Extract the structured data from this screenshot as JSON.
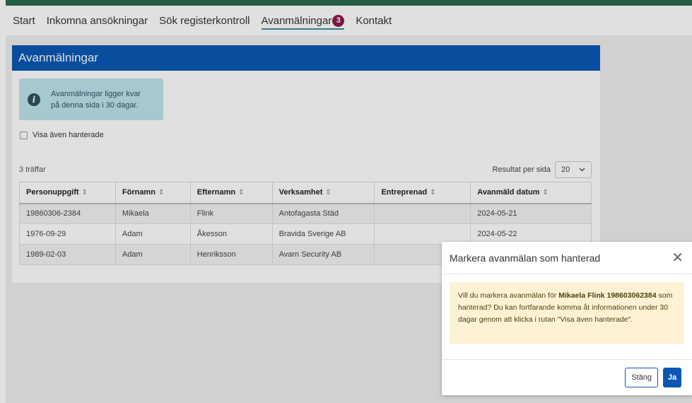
{
  "nav": {
    "items": [
      "Start",
      "Inkomna ansökningar",
      "Sök registerkontroll",
      "Avanmälningar",
      "Kontakt"
    ],
    "badge": "3"
  },
  "card": {
    "title": "Avanmälningar",
    "info_text": "Avanmälningar ligger kvar på denna sida i 30 dagar.",
    "checkbox_label": "Visa även hanterade",
    "hits": "3 träffar",
    "per_page_label": "Resultat per sida",
    "per_page_value": "20"
  },
  "table": {
    "headers": [
      "Personuppgift",
      "Förnamn",
      "Efternamn",
      "Verksamhet",
      "Entreprenad",
      "Avanmäld datum"
    ],
    "rows": [
      [
        "19860306-2384",
        "Mikaela",
        "Flink",
        "Antofagasta Städ",
        "",
        "2024-05-21"
      ],
      [
        "1976-09-29",
        "Adam",
        "Åkesson",
        "Bravida Sverige AB",
        "",
        "2024-05-22"
      ],
      [
        "1989-02-03",
        "Adam",
        "Henriksson",
        "Avarn Security AB",
        "",
        ""
      ]
    ]
  },
  "modal": {
    "title": "Markera avanmälan som hanterad",
    "text_before": "Vill du markera avanmälan för ",
    "text_bold": "Mikaela Flink 198603062384",
    "text_after": " som hanterad? Du kan fortfarande komma åt informationen under 30 dagar genom att klicka i rutan \"Visa även hanterade\".",
    "close_label": "Stäng",
    "yes_label": "Ja"
  }
}
